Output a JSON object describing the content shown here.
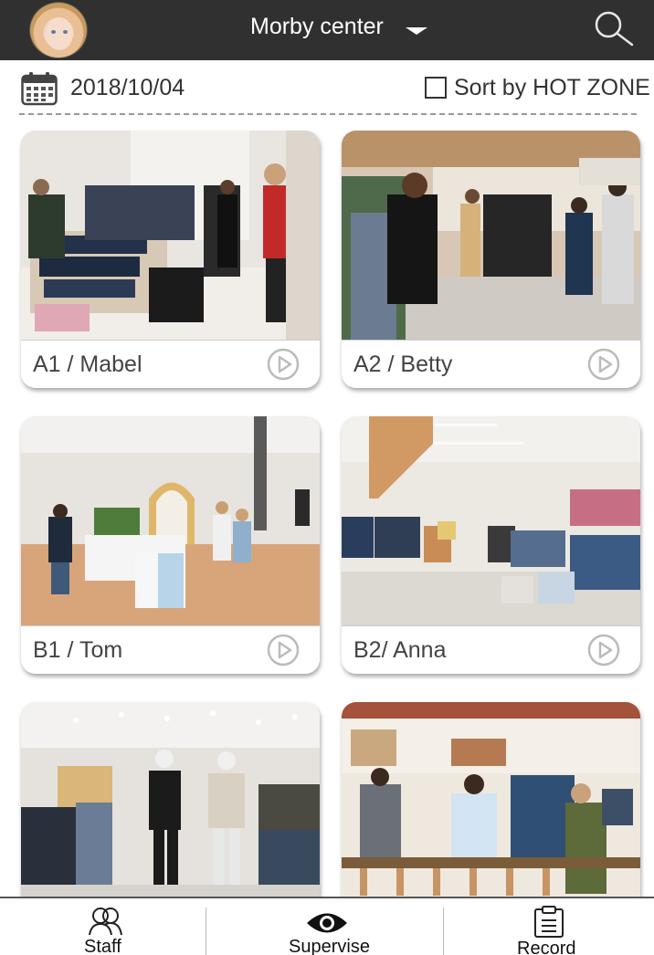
{
  "header": {
    "title": "Morby center",
    "avatar_icon": "user-avatar",
    "dropdown_icon": "caret-down-icon",
    "search_icon": "search-icon"
  },
  "toolbar": {
    "date": "2018/10/04",
    "calendar_icon": "calendar-icon",
    "sort_label": "Sort by HOT ZONE",
    "sort_checked": false
  },
  "cards": [
    {
      "label": "A1 / Mabel",
      "scene": "clothing-store-photo"
    },
    {
      "label": "A2 / Betty",
      "scene": "clothing-store-photo"
    },
    {
      "label": "B1 / Tom",
      "scene": "clothing-store-photo"
    },
    {
      "label": "B2/ Anna",
      "scene": "clothing-store-photo"
    },
    {
      "label": "",
      "scene": "clothing-store-photo"
    },
    {
      "label": "",
      "scene": "clothing-store-photo"
    }
  ],
  "bottom_nav": {
    "items": [
      {
        "label": "Staff",
        "icon": "staff-icon"
      },
      {
        "label": "Supervise",
        "icon": "eye-icon"
      },
      {
        "label": "Record",
        "icon": "clipboard-icon"
      }
    ]
  },
  "colors": {
    "header_bg": "#303030",
    "header_text": "#ffffff",
    "card_label": "#444444",
    "play_icon": "#bbbbbb"
  }
}
